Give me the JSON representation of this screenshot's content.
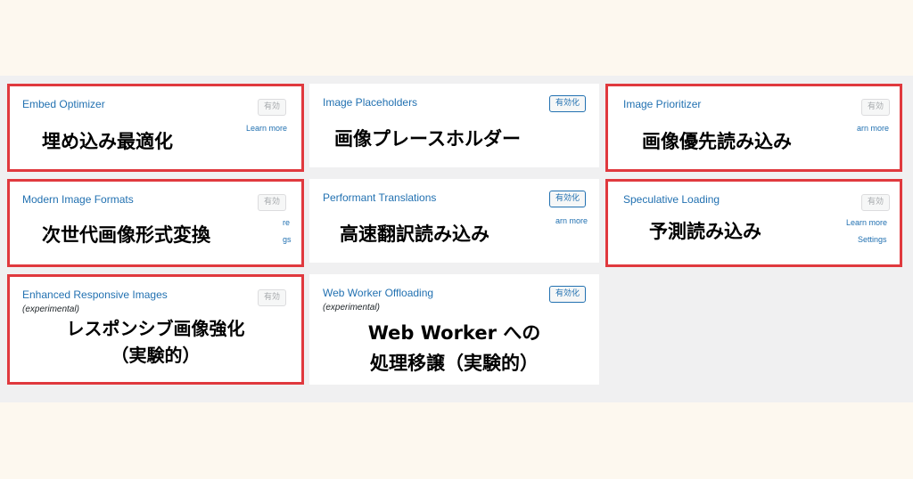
{
  "cards": {
    "embed": {
      "title": "Embed Optimizer",
      "button": "有効",
      "link1": "Learn more",
      "overlay": "埋め込み最適化"
    },
    "placeholders": {
      "title": "Image Placeholders",
      "button": "有効化",
      "overlay": "画像プレースホルダー"
    },
    "prioritizer": {
      "title": "Image Prioritizer",
      "button": "有効",
      "link1": "arn more",
      "overlay": "画像優先読み込み"
    },
    "modern": {
      "title": "Modern Image Formats",
      "button": "有効",
      "link1": "re",
      "link2": "gs",
      "overlay": "次世代画像形式変換"
    },
    "translations": {
      "title": "Performant Translations",
      "button": "有効化",
      "link1": "arn more",
      "overlay": "高速翻訳読み込み"
    },
    "speculative": {
      "title": "Speculative Loading",
      "button": "有効",
      "link1": "Learn more",
      "link2": "Settings",
      "overlay": "予測読み込み"
    },
    "enhanced": {
      "title": "Enhanced Responsive Images",
      "subtitle": "(experimental)",
      "button": "有効",
      "overlay_line1": "レスポンシブ画像強化",
      "overlay_line2": "（実験的）"
    },
    "webworker": {
      "title": "Web Worker Offloading",
      "subtitle": "(experimental)",
      "button": "有効化",
      "overlay_line1": "Web Worker への",
      "overlay_line2": "処理移譲（実験的）"
    }
  },
  "colors": {
    "highlight": "#e0393e",
    "link": "#2271b1",
    "background": "#fdf8ef",
    "panel": "#f0f0f1"
  }
}
